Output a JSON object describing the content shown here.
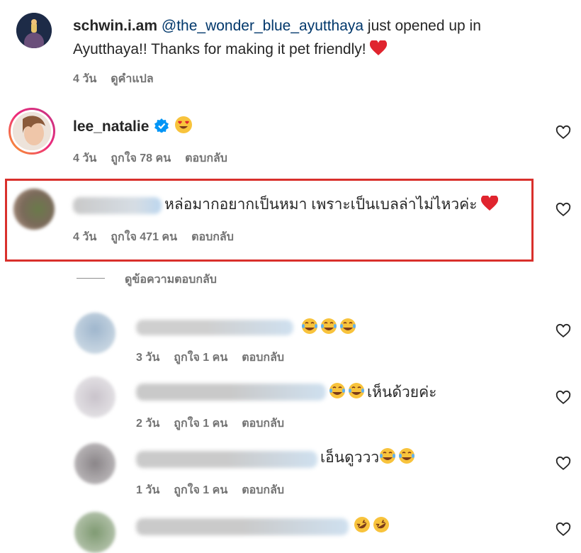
{
  "comments": [
    {
      "username": "schwin.i.am",
      "mention": "@the_wonder_blue_ayutthaya",
      "text_line1": " just opened up in",
      "text_line2": "Ayutthaya!! Thanks for making it pet friendly!",
      "time": "4 วัน",
      "translate": "ดูคำแปล"
    },
    {
      "username": "lee_natalie",
      "time": "4 วัน",
      "likes": "ถูกใจ 78 คน",
      "reply": "ตอบกลับ"
    },
    {
      "text": "หล่อมากอยากเป็นหมา เพราะเป็นเบลล่าไม่ไหวค่ะ",
      "time": "4 วัน",
      "likes": "ถูกใจ 471 คน",
      "reply": "ตอบกลับ"
    }
  ],
  "view_replies": "ดูข้อความตอบกลับ",
  "replies": [
    {
      "text": "",
      "time": "3 วัน",
      "likes": "ถูกใจ 1 คน",
      "reply": "ตอบกลับ"
    },
    {
      "text": "เห็นด้วยค่ะ",
      "time": "2 วัน",
      "likes": "ถูกใจ 1 คน",
      "reply": "ตอบกลับ"
    },
    {
      "text": "เอ็นดูววว",
      "time": "1 วัน",
      "likes": "ถูกใจ 1 คน",
      "reply": "ตอบกลับ"
    },
    {
      "text": ""
    }
  ],
  "colors": {
    "highlight_border": "#d9302c",
    "verified": "#0095f6",
    "mention": "#00376b",
    "meta": "#737373"
  }
}
